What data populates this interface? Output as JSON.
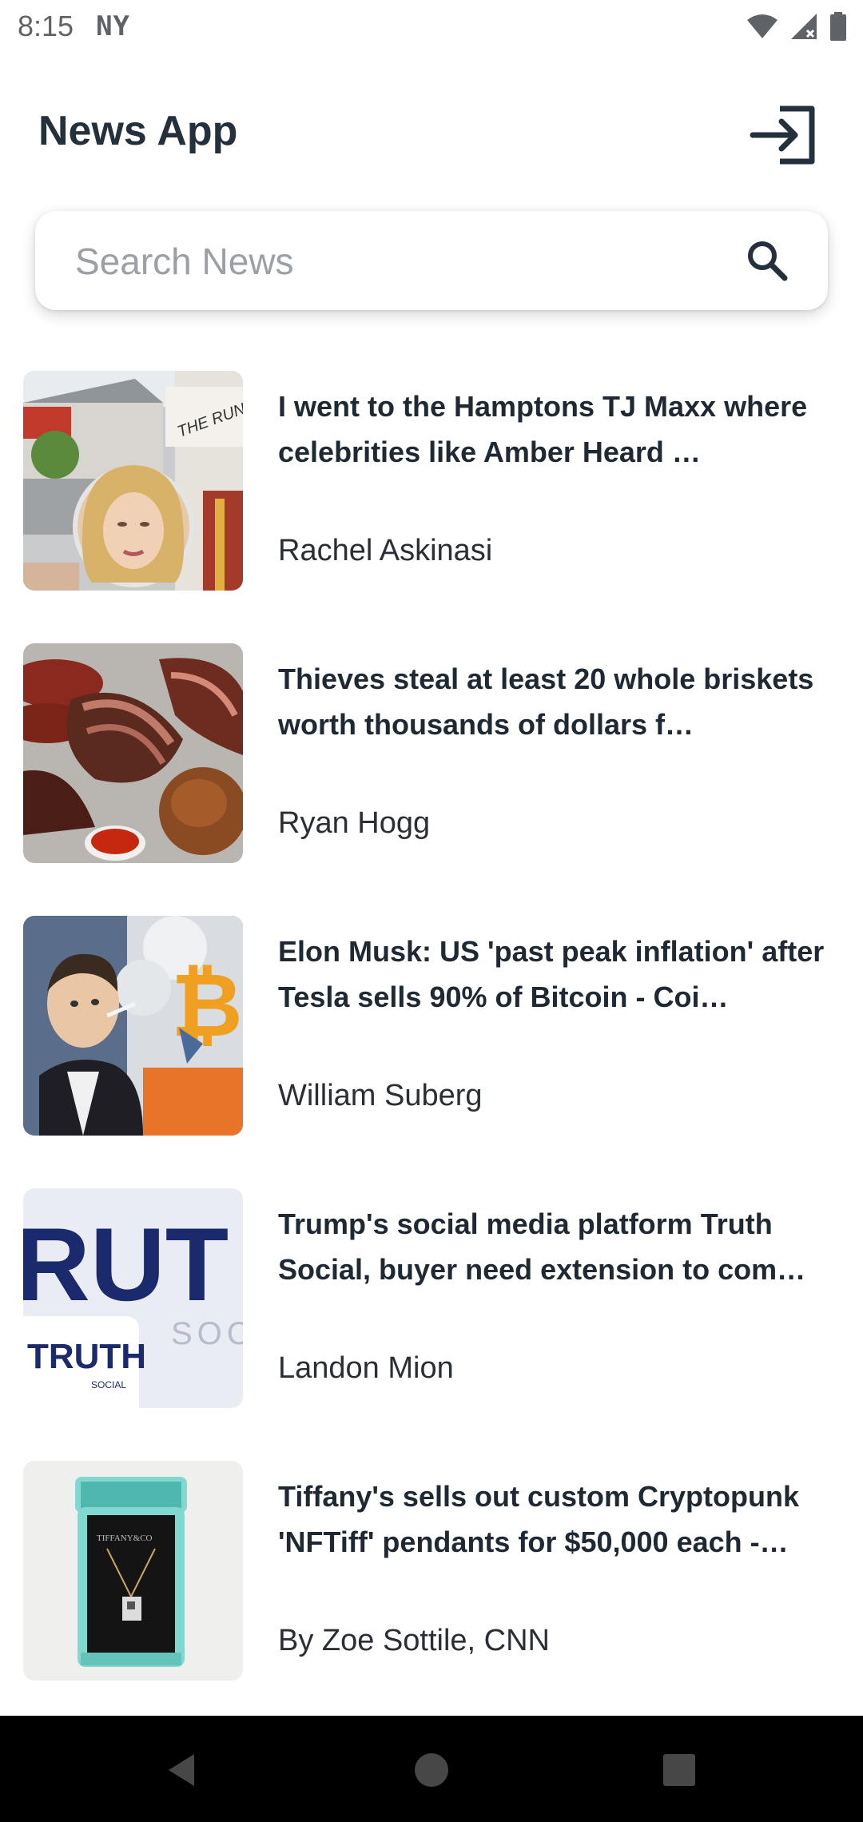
{
  "status_bar": {
    "time": "8:15",
    "carrier": "NY"
  },
  "app": {
    "title": "News App"
  },
  "icons": {
    "login": "login-icon",
    "search": "search-icon",
    "wifi": "wifi-icon",
    "signal": "signal-icon",
    "battery": "battery-icon",
    "back": "back-triangle-icon",
    "home": "home-circle-icon",
    "recents": "recents-square-icon"
  },
  "search": {
    "placeholder": "Search News",
    "value": ""
  },
  "articles": [
    {
      "title": "I went to the Hamptons TJ Maxx where celebrities like Amber Heard …",
      "author": "Rachel Askinasi"
    },
    {
      "title": "Thieves steal at least 20 whole briskets worth thousands of dollars f…",
      "author": "Ryan Hogg"
    },
    {
      "title": "Elon Musk: US 'past peak inflation' after Tesla sells 90% of Bitcoin - Coi…",
      "author": "William Suberg"
    },
    {
      "title": "Trump's social media platform Truth Social, buyer need extension to com…",
      "author": "Landon Mion"
    },
    {
      "title": "Tiffany's sells out custom Cryptopunk 'NFTiff' pendants for $50,000 each -…",
      "author": "By Zoe Sottile, CNN"
    }
  ],
  "thumbnail_text": {
    "runway": "THE RUNWAY",
    "truth_big": "RUT",
    "truth_small": "TRUTH",
    "truth_social": "SOCIAL",
    "soc": "SOC",
    "tiffany": "TIFFANY&CO"
  },
  "colors": {
    "title": "#24303b",
    "text": "#1f2933",
    "placeholder": "#9aa0a6",
    "nav_bar": "#000000",
    "tiffany_blue": "#81d8d0",
    "truth_navy": "#1a2a6c"
  }
}
